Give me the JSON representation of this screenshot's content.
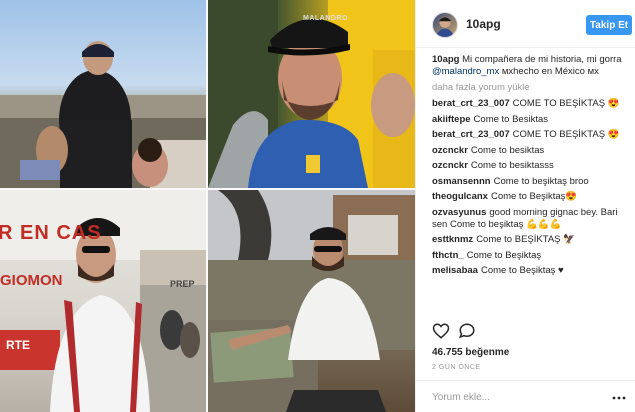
{
  "post": {
    "username": "10apg",
    "follow_label": "Takip Et",
    "caption": {
      "author": "10apg",
      "text_before": "Mi compañera de mi historia, mi gorra",
      "mention": "@malandro_mx",
      "text_after": "мхhecho en México мх"
    },
    "load_more": "daha fazla yorum yükle",
    "comments": [
      {
        "author": "berat_crt_23_007",
        "text": "COME TO BEŞİKTAŞ 😍"
      },
      {
        "author": "akiiftepe",
        "text": "Come to Besiktas"
      },
      {
        "author": "berat_crt_23_007",
        "text": "COME TO BEŞİKTAŞ 😍"
      },
      {
        "author": "ozcnckr",
        "text": "Come to besiktas"
      },
      {
        "author": "ozcnckr",
        "text": "Come to besiktasss"
      },
      {
        "author": "osmansennn",
        "text": "Come to beşiktaş broo"
      },
      {
        "author": "theogulcanx",
        "text": "Come to Beşiktaş😍"
      },
      {
        "author": "ozvasyunus",
        "text": "good morning gignac bey. Bari sen Come to beşiktaş 💪💪💪"
      },
      {
        "author": "esttknmz",
        "text": "Come to BEŞİKTAŞ 🦅"
      },
      {
        "author": "fthctn_",
        "text": "Come to Beşiktaş"
      },
      {
        "author": "melisabaa",
        "text": "Come to Beşiktaş ♥"
      },
      {
        "author": "",
        "text": ""
      }
    ],
    "likes": "46.755 beğenme",
    "time": "2 GÜN ÖNCE",
    "add_comment_placeholder": "Yorum ekle...",
    "icons": {
      "like": "heart-icon",
      "comment": "comment-icon",
      "more": "more-options-icon"
    }
  },
  "photos": {
    "sign_text_1": "R EN CAS",
    "sign_text_2": "GIOMON",
    "sign_text_3": "RTE",
    "sign_text_4": "PREP",
    "cap_text": "MALANDRO"
  }
}
